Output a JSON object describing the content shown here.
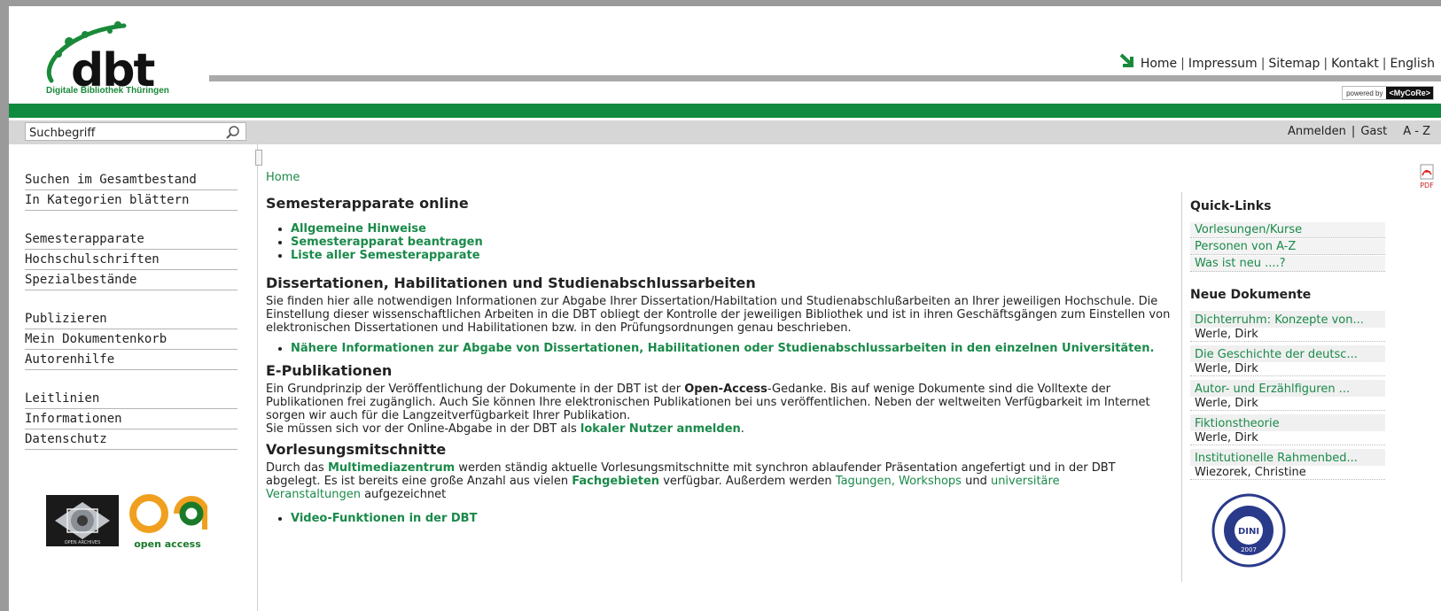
{
  "header": {
    "logo_text": "dbt",
    "logo_subtitle": "Digitale Bibliothek Thüringen",
    "nav": [
      "Home",
      "Impressum",
      "Sitemap",
      "Kontakt",
      "English"
    ],
    "powered_by": "powered by",
    "powered_brand": "<MyCoRe>"
  },
  "toolbar": {
    "search_placeholder": "Suchbegriff",
    "login": "Anmelden",
    "guest": "Gast",
    "az": "A - Z"
  },
  "leftnav": {
    "groups": [
      [
        "Suchen im Gesamtbestand",
        "In Kategorien blättern"
      ],
      [
        "Semesterapparate",
        "Hochschulschriften",
        "Spezialbestände"
      ],
      [
        "Publizieren",
        "Mein Dokumentenkorb",
        "Autorenhilfe"
      ],
      [
        "Leitlinien",
        "Informationen",
        "Datenschutz"
      ]
    ],
    "badge_archive": "OPEN ARCHIVES",
    "badge_oa": "open access"
  },
  "main": {
    "breadcrumb": "Home",
    "s1_title": "Semesterapparate online",
    "s1_items": [
      "Allgemeine Hinweise",
      "Semesterapparat beantragen",
      "Liste aller Semesterapparate"
    ],
    "s2_title": "Dissertationen, Habilitationen und Studienabschlussarbeiten",
    "s2_text": "Sie finden hier alle notwendigen Informationen zur Abgabe Ihrer Dissertation/Habiltation und Studienabschlußarbeiten an Ihrer jeweiligen Hochschule. Die Einstellung dieser wissenschaftlichen Arbeiten in die DBT obliegt der Kontrolle der jeweiligen Bibliothek und ist in ihren Geschäftsgängen zum Einstellen von elektronischen Dissertationen und Habilitationen bzw. in den Prüfungsordnungen genau beschrieben.",
    "s2_link": "Nähere Informationen zur Abgabe von Dissertationen, Habilitationen oder Studienabschlussarbeiten in den einzelnen Universitäten.",
    "s3_title": "E-Publikationen",
    "s3_text_a": "Ein Grundprinzip der Veröffentlichung der Dokumente in der DBT ist der ",
    "s3_bold": "Open-Access",
    "s3_text_b": "-Gedanke. Bis auf wenige Dokumente sind die Volltexte der Publikationen frei zugänglich. Auch Sie können Ihre elektronischen Publikationen bei uns veröffentlichen. Neben der weltweiten Verfügbarkeit im Internet sorgen wir auch für die Langzeitverfügbarkeit Ihrer Publikation.",
    "s3_text_c": "Sie müssen sich vor der Online-Abgabe in der DBT als ",
    "s3_link": "lokaler Nutzer anmelden",
    "s3_text_d": ".",
    "s4_title": "Vorlesungsmitschnitte",
    "s4_a": "Durch das ",
    "s4_link1": "Multimediazentrum",
    "s4_b": " werden ständig aktuelle Vorlesungsmitschnitte mit synchron ablaufender Präsentation angefertigt und in der DBT abgelegt. Es ist bereits eine große Anzahl aus vielen ",
    "s4_link2": "Fachgebieten",
    "s4_c": " verfügbar. Außerdem werden ",
    "s4_link3": "Tagungen, Workshops",
    "s4_d": " und ",
    "s4_link4": "universitäre Veranstaltungen",
    "s4_e": " aufgezeichnet",
    "s4_item": "Video-Funktionen in der DBT"
  },
  "right": {
    "pdf_label": "PDF",
    "quick_title": "Quick-Links",
    "quick_links": [
      "Vorlesungen/Kurse",
      "Personen von A-Z",
      "Was ist neu ....?"
    ],
    "new_title": "Neue Dokumente",
    "docs": [
      {
        "title": "Dichterruhm: Konzepte von...",
        "author": "Werle, Dirk"
      },
      {
        "title": "Die Geschichte der deutsc...",
        "author": "Werle, Dirk"
      },
      {
        "title": "Autor- und Erzählfiguren ...",
        "author": "Werle, Dirk"
      },
      {
        "title": "Fiktionstheorie",
        "author": "Werle, Dirk"
      },
      {
        "title": "Institutionelle Rahmenbed...",
        "author": "Wiezorek, Christine"
      }
    ],
    "dini_label": "DINI",
    "dini_year": "2007"
  },
  "colors": {
    "brand_green": "#108a3e",
    "link_green": "#1a8a4a"
  }
}
